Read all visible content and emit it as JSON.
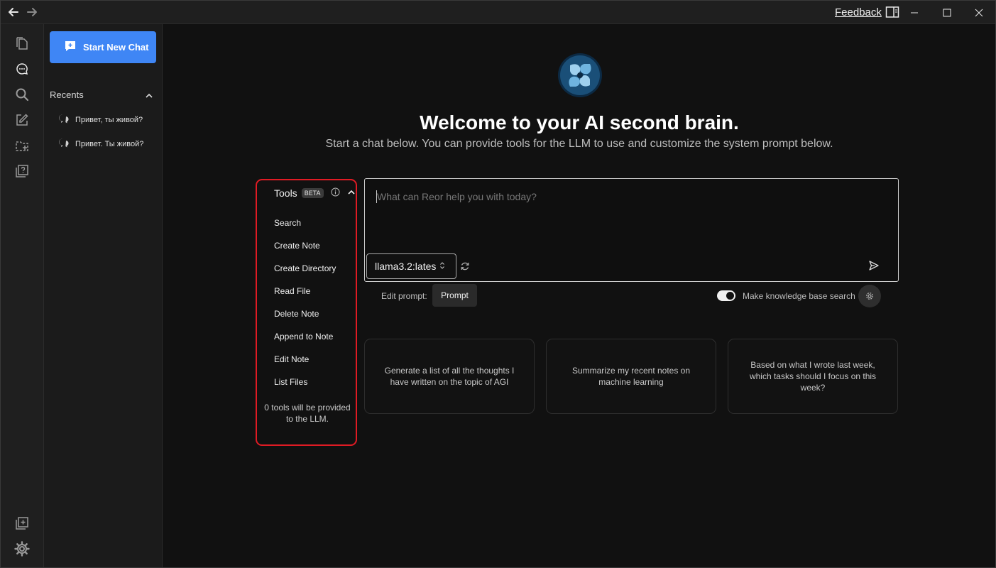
{
  "titlebar": {
    "feedback_label": "Feedback"
  },
  "sidebar": {
    "new_chat_label": "Start New Chat",
    "recents_label": "Recents",
    "recent_chats": [
      "Привет, ты живой?",
      "Привет. Ты живой?"
    ]
  },
  "main": {
    "title": "Welcome to your AI second brain.",
    "subtitle": "Start a chat below. You can provide tools for the LLM to use and customize the system prompt below."
  },
  "tools": {
    "header": "Tools",
    "badge": "BETA",
    "items": [
      "Search",
      "Create Note",
      "Create Directory",
      "Read File",
      "Delete Note",
      "Append to Note",
      "Edit Note",
      "List Files"
    ],
    "footer": "0 tools will be provided to the LLM."
  },
  "chat": {
    "placeholder": "What can Reor help you with today?",
    "model": "llama3.2:lates"
  },
  "options": {
    "edit_prompt_label": "Edit prompt:",
    "prompt_button": "Prompt",
    "kb_search_label": "Make knowledge base search",
    "kb_search_enabled": true
  },
  "suggestions": [
    "Generate a list of all the thoughts I have written on the topic of AGI",
    "Summarize my recent notes on machine learning",
    "Based on what I wrote last week, which tasks should I focus on this week?"
  ],
  "colors": {
    "accent": "#3f86f5",
    "highlight_border": "#e01b24",
    "background": "#111111"
  }
}
